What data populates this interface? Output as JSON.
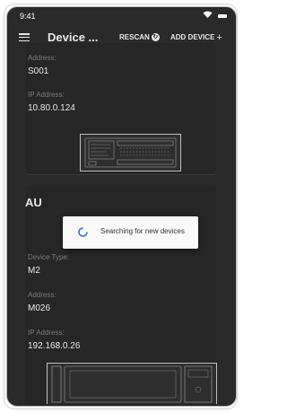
{
  "status_bar": {
    "time": "9:41"
  },
  "app_bar": {
    "title": "Device ...",
    "rescan_label": "RESCAN",
    "add_device_label": "ADD DEVICE"
  },
  "device_1": {
    "address_label": "Address:",
    "address_value": "S001",
    "ip_label": "IP Address:",
    "ip_value": "10.80.0.124"
  },
  "device_2": {
    "name": "AU",
    "type_label": "Device Type:",
    "type_value": "M2",
    "address_label": "Address:",
    "address_value": "M026",
    "ip_label": "IP Address:",
    "ip_value": "192.168.0.26"
  },
  "dialog": {
    "message": "Searching for new devices"
  },
  "colors": {
    "background": "#2a2a2a",
    "text": "#e8e8e8",
    "muted": "#7b7b7b",
    "dialog": "#fafafa",
    "spinner": "#3b6fd4"
  }
}
